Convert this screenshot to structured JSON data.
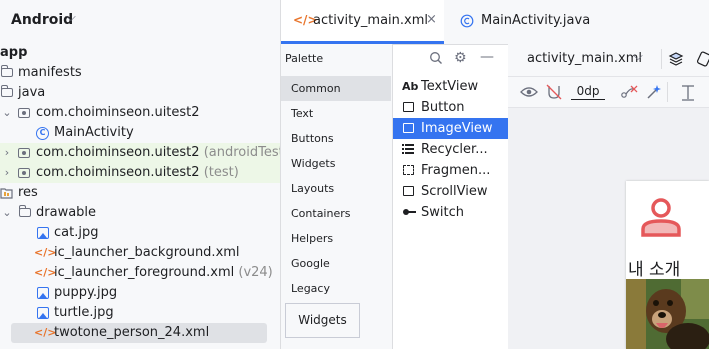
{
  "project": {
    "title": "Android",
    "tree": [
      {
        "label": "app",
        "suffix": ""
      },
      {
        "label": "manifests",
        "suffix": ""
      },
      {
        "label": "java",
        "suffix": ""
      },
      {
        "label": "com.choiminseon.uitest2",
        "suffix": ""
      },
      {
        "label": "MainActivity",
        "suffix": ""
      },
      {
        "label": "com.choiminseon.uitest2",
        "suffix": "(androidTest)"
      },
      {
        "label": "com.choiminseon.uitest2",
        "suffix": "(test)"
      },
      {
        "label": "res",
        "suffix": ""
      },
      {
        "label": "drawable",
        "suffix": ""
      },
      {
        "label": "cat.jpg",
        "suffix": ""
      },
      {
        "label": "ic_launcher_background.xml",
        "suffix": ""
      },
      {
        "label": "ic_launcher_foreground.xml",
        "suffix": "(v24)"
      },
      {
        "label": "puppy.jpg",
        "suffix": ""
      },
      {
        "label": "turtle.jpg",
        "suffix": ""
      },
      {
        "label": "twotone_person_24.xml",
        "suffix": ""
      }
    ]
  },
  "tabs": [
    {
      "label": "activity_main.xml",
      "active": true
    },
    {
      "label": "MainActivity.java",
      "active": false
    }
  ],
  "palette": {
    "title": "Palette",
    "categories": [
      "Common",
      "Text",
      "Buttons",
      "Widgets",
      "Layouts",
      "Containers",
      "Helpers",
      "Google",
      "Legacy"
    ],
    "active_category": "Common",
    "components": [
      {
        "icon": "Ab",
        "label": "TextView"
      },
      {
        "icon": "button-icon",
        "label": "Button"
      },
      {
        "icon": "image-icon",
        "label": "ImageView"
      },
      {
        "icon": "list-icon",
        "label": "Recycler..."
      },
      {
        "icon": "fragment-icon",
        "label": "Fragmen..."
      },
      {
        "icon": "scroll-icon",
        "label": "ScrollView"
      },
      {
        "icon": "switch-icon",
        "label": "Switch"
      }
    ],
    "selected_component": "ImageView",
    "widgets_button": "Widgets"
  },
  "design": {
    "file_dropdown": "activity_main.xml",
    "margin_value": "0dp",
    "preview_text": "내 소개"
  },
  "colors": {
    "accent": "#3574f0",
    "xml_icon": "#e8742b",
    "person_icon": "#e5585a",
    "green_row": "#edf7e7"
  }
}
